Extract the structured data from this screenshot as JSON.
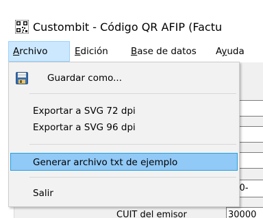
{
  "window": {
    "title": "Custombit - Código QR AFIP (Factu"
  },
  "menubar": {
    "items": [
      {
        "label": "Archivo",
        "underline": "A",
        "active": true
      },
      {
        "label": "Edición",
        "underline": "E"
      },
      {
        "label": "Base de datos",
        "underline": "B"
      },
      {
        "label": "Ayuda",
        "underline": "y"
      }
    ]
  },
  "archivo_menu": {
    "save_as": "Guardar como...",
    "export_svg_72": "Exportar a SVG 72 dpi",
    "export_svg_96": "Exportar a SVG 96 dpi",
    "generate_example": "Generar archivo txt de ejemplo",
    "exit": "Salir"
  },
  "background_form": {
    "date_value_partial": "020-",
    "cuit_label_partial": "CUIT del emisor",
    "cuit_value_partial": "30000"
  },
  "colors": {
    "menu_highlight": "#91c9f7",
    "menu_highlight_border": "#26a0da",
    "menubar_active": "#cce8ff"
  }
}
